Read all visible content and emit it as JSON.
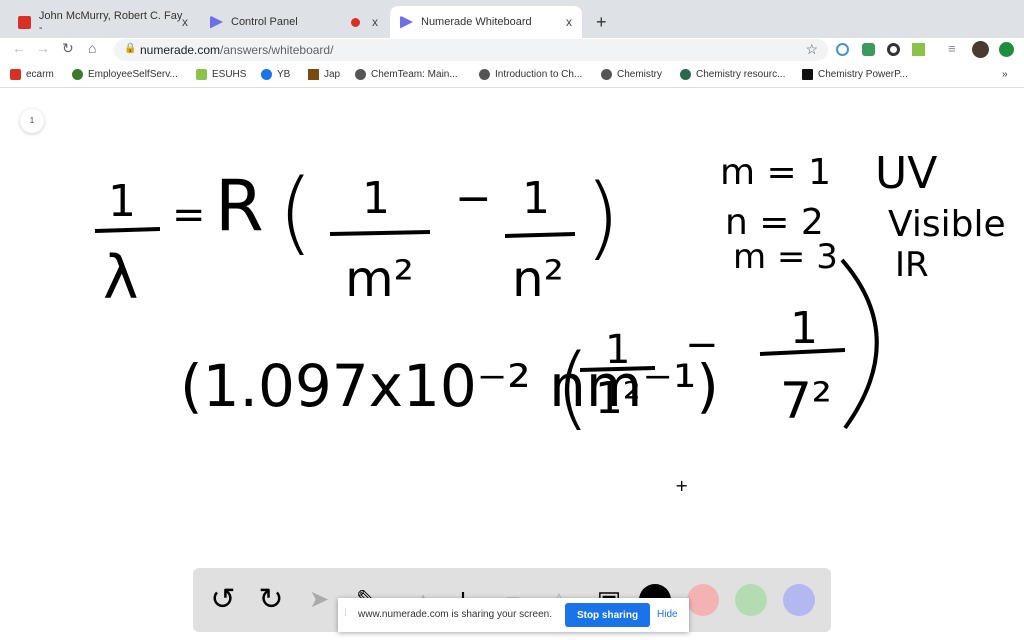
{
  "browser": {
    "tabs": [
      {
        "label": "John McMurry, Robert C. Fay -",
        "icon": "pdf-icon",
        "active": false
      },
      {
        "label": "Control Panel",
        "icon": "numerade-icon",
        "active": false,
        "recording": true
      },
      {
        "label": "Numerade Whiteboard",
        "icon": "numerade-icon",
        "active": true
      }
    ],
    "close_glyph": "x",
    "new_tab": "+",
    "url_host": "numerade.com",
    "url_path": "/answers/whiteboard/",
    "bookmarks": [
      "ecarm",
      "EmployeeSelfServ...",
      "ESUHS",
      "YB",
      "Jap",
      "ChemTeam: Main...",
      "Introduction to Ch...",
      "Chemistry",
      "Chemistry resourc...",
      "Chemistry PowerP..."
    ],
    "more": "»"
  },
  "page_indicator": "1",
  "whiteboard": {
    "eq1": {
      "lhs_num": "1",
      "lhs_den": "λ",
      "eq": "=",
      "R": "R",
      "lp": "(",
      "f1_num": "1",
      "f1_den": "m²",
      "minus": "−",
      "f2_num": "1",
      "f2_den": "n²",
      "rp": ")"
    },
    "notes": [
      {
        "eq": "m = 1",
        "label": "UV"
      },
      {
        "eq": "n = 2",
        "label": "Visible"
      },
      {
        "eq": "m = 3",
        "label": "IR"
      }
    ],
    "eq2": {
      "constant": "(1.097x10⁻² nm⁻¹)",
      "lp": "(",
      "f1_num": "1",
      "f1_den": "1²",
      "minus": "−",
      "f2_num": "1",
      "f2_den": "7²",
      "rp": ")"
    },
    "cursor": "+"
  },
  "toolbar": {
    "colors": [
      "#000000",
      "#f4b3b3",
      "#b3dcb3",
      "#b3b8f0"
    ]
  },
  "share_bar": {
    "message": "www.numerade.com is sharing your screen.",
    "stop": "Stop sharing",
    "hide": "Hide"
  }
}
